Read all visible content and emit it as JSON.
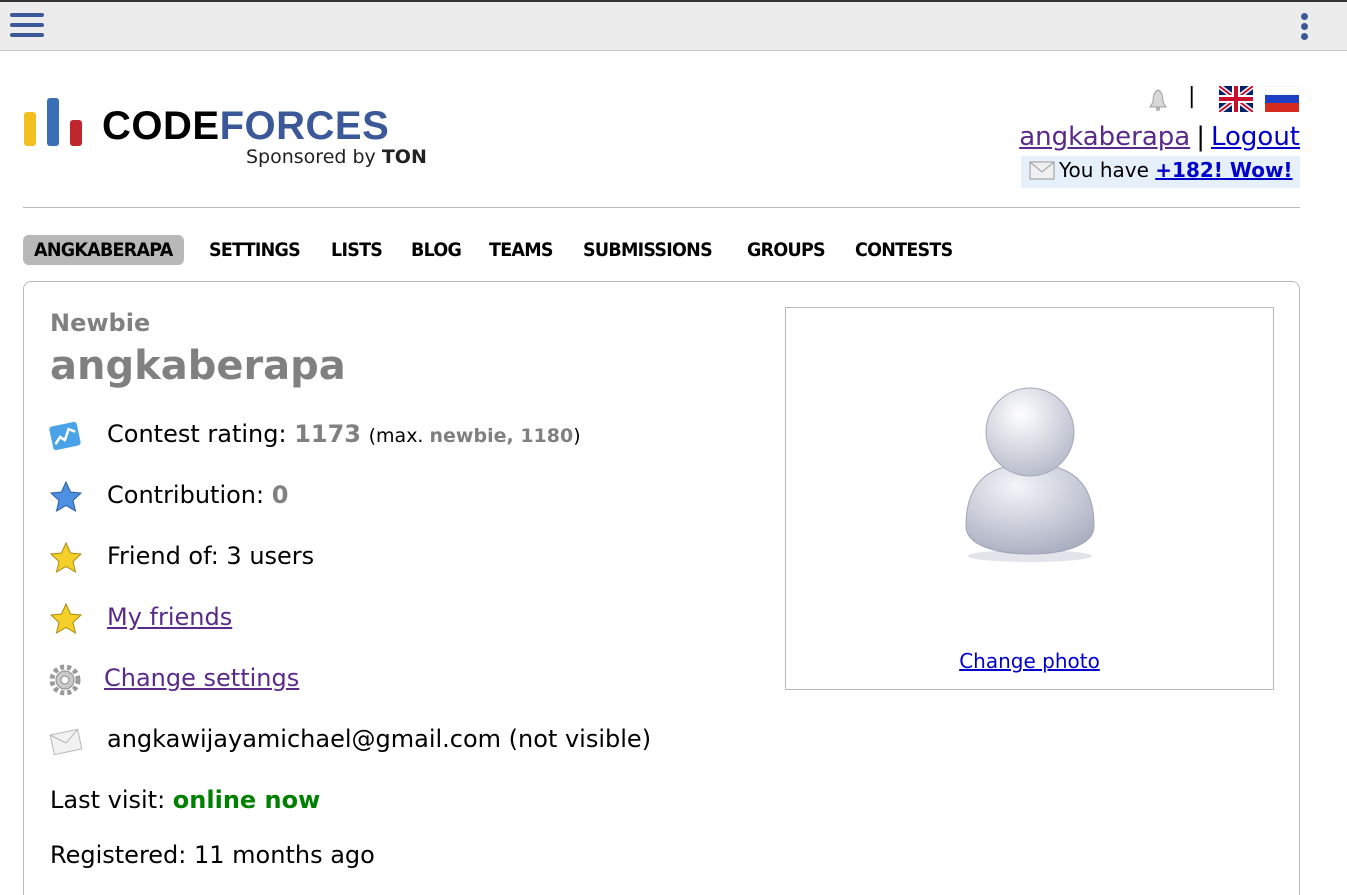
{
  "topbar": {
    "menu_icon": "hamburger-menu-icon",
    "more_icon": "kebab-menu-icon"
  },
  "logo": {
    "word_code": "CODE",
    "word_forces": "FORCES",
    "sponsor_prefix": "Sponsored by ",
    "sponsor_name": "TON"
  },
  "header": {
    "bell_icon": "bell-icon",
    "language_separator": "|",
    "flags": [
      "uk-flag-icon",
      "russia-flag-icon"
    ],
    "username_link": "angkaberapa",
    "links_separator": "|",
    "logout_link": "Logout",
    "notice_prefix": "You have ",
    "notice_link": "+182! Wow!"
  },
  "nav": {
    "items": [
      {
        "label": "ANGKABERAPA",
        "active": true
      },
      {
        "label": "SETTINGS",
        "active": false
      },
      {
        "label": "LISTS",
        "active": false
      },
      {
        "label": "BLOG",
        "active": false
      },
      {
        "label": "TEAMS",
        "active": false
      },
      {
        "label": "SUBMISSIONS",
        "active": false
      },
      {
        "label": "GROUPS",
        "active": false
      },
      {
        "label": "CONTESTS",
        "active": false
      }
    ]
  },
  "profile": {
    "rank": "Newbie",
    "handle": "angkaberapa",
    "rating_label": "Contest rating: ",
    "rating_value": "1173",
    "rating_max_prefix": "(max. ",
    "rating_max_rank": "newbie, 1180",
    "rating_max_suffix": ")",
    "contribution_label": "Contribution: ",
    "contribution_value": "0",
    "friend_of": "Friend of: 3 users",
    "my_friends_link": "My friends",
    "change_settings_link": "Change settings",
    "email": "angkawijayamichael@gmail.com (not visible)",
    "last_visit_label": "Last visit: ",
    "last_visit_value": "online now",
    "registered": "Registered: 11 months ago",
    "change_photo_link": "Change photo"
  },
  "colors": {
    "rank_gray": "#808080",
    "link_purple": "#5a2a8a",
    "link_blue": "#0000cc",
    "online_green": "#008000",
    "brand_blue": "#3b5998"
  }
}
